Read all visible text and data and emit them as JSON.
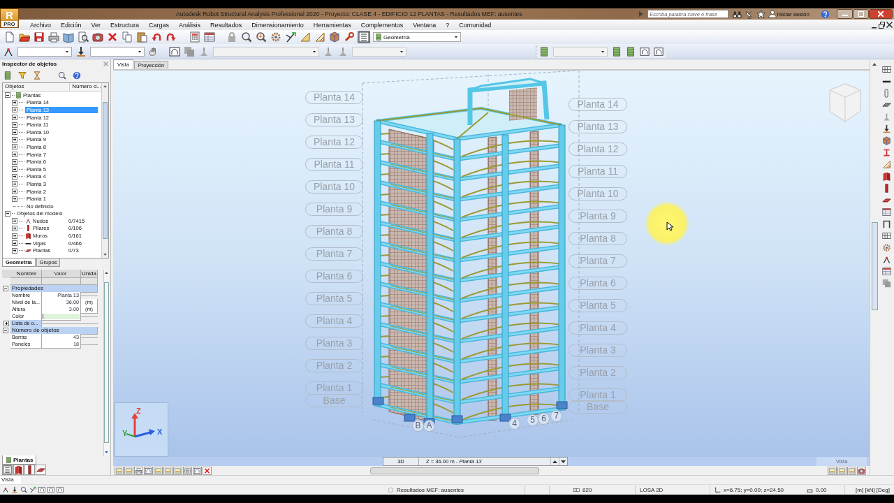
{
  "app_button": {
    "letter": "R",
    "label": "PRO"
  },
  "window": {
    "title": "Autodesk Robot Structural Analysis Professional 2020 - Proyecto: CLASE 4 - EDIFICIO 12 PLANTAS - Resultados MEF: ausentes"
  },
  "search": {
    "placeholder": "Escriba palabra clave o frase"
  },
  "sign_in": "Iniciar sesión",
  "menu": [
    "Archivo",
    "Edición",
    "Ver",
    "Estructura",
    "Cargas",
    "Análisis",
    "Resultados",
    "Dimensionamiento",
    "Herramientas",
    "Complementos",
    "Ventana",
    "?",
    "Comunidad"
  ],
  "toolbar": {
    "view_dropdown": "Geometría"
  },
  "inspector": {
    "title": "Inspector de objetos",
    "columns": [
      "Objetos",
      "Número d..."
    ],
    "tree": [
      {
        "label": "Plantas",
        "kind": "storeys",
        "expanded": true,
        "selected": false,
        "children": [
          {
            "label": "Planta 14",
            "kind": "storey",
            "expanded": false,
            "selected": false
          },
          {
            "label": "Planta 13",
            "kind": "storey",
            "expanded": false,
            "selected": true
          },
          {
            "label": "Planta 12",
            "kind": "storey",
            "expanded": false,
            "selected": false
          },
          {
            "label": "Planta 11",
            "kind": "storey",
            "expanded": false,
            "selected": false
          },
          {
            "label": "Planta 10",
            "kind": "storey",
            "expanded": false,
            "selected": false
          },
          {
            "label": "Planta 9",
            "kind": "storey",
            "expanded": false,
            "selected": false
          },
          {
            "label": "Planta 8",
            "kind": "storey",
            "expanded": false,
            "selected": false
          },
          {
            "label": "Planta 7",
            "kind": "storey",
            "expanded": false,
            "selected": false
          },
          {
            "label": "Planta 6",
            "kind": "storey",
            "expanded": false,
            "selected": false
          },
          {
            "label": "Planta 5",
            "kind": "storey",
            "expanded": false,
            "selected": false
          },
          {
            "label": "Planta 4",
            "kind": "storey",
            "expanded": false,
            "selected": false
          },
          {
            "label": "Planta 3",
            "kind": "storey",
            "expanded": false,
            "selected": false
          },
          {
            "label": "Planta 2",
            "kind": "storey",
            "expanded": false,
            "selected": false
          },
          {
            "label": "Planta 1",
            "kind": "storey",
            "expanded": false,
            "selected": false
          },
          {
            "label": "No definido",
            "kind": "leaf",
            "selected": false
          }
        ]
      },
      {
        "label": "Objetos del modelo",
        "kind": "group",
        "expanded": true,
        "selected": false,
        "children": [
          {
            "label": "Nudos",
            "kind": "node",
            "count": "0/7415",
            "expanded": false,
            "selected": false
          },
          {
            "label": "Pilares",
            "kind": "column",
            "count": "0/106",
            "expanded": false,
            "selected": false
          },
          {
            "label": "Muros",
            "kind": "wall",
            "count": "0/161",
            "expanded": false,
            "selected": false
          },
          {
            "label": "Vigas",
            "kind": "beam",
            "count": "0/466",
            "expanded": false,
            "selected": false
          },
          {
            "label": "Plantas",
            "kind": "slab",
            "count": "0/73",
            "expanded": false,
            "selected": false
          }
        ]
      }
    ],
    "tabs": [
      {
        "label": "Geometría",
        "selected": true
      },
      {
        "label": "Grupos",
        "selected": false
      }
    ]
  },
  "properties": {
    "columns": [
      "Nombre",
      "Valor",
      "Unida"
    ],
    "sections": [
      {
        "label": "Propiedades",
        "expanded": true,
        "rows": [
          {
            "kind": "text",
            "name": "Nombre",
            "value": "Planta 13"
          },
          {
            "kind": "text",
            "name": "Nivel de la...",
            "value": "36.00",
            "unit": "(m)"
          },
          {
            "kind": "text",
            "name": "Altura",
            "value": "3.00",
            "unit": "(m)"
          },
          {
            "kind": "color",
            "name": "Color",
            "color": "#dff3dc"
          },
          {
            "kind": "group",
            "name": "Lista de o...",
            "expanded": false
          }
        ]
      },
      {
        "label": "Número de objetos",
        "expanded": true,
        "rows": [
          {
            "kind": "text",
            "name": "Barras",
            "value": "43"
          },
          {
            "kind": "text",
            "name": "Paneles",
            "value": "18"
          }
        ]
      }
    ]
  },
  "panel_tab": "Plantas",
  "view_tabs": [
    {
      "label": "Vista",
      "selected": true
    },
    {
      "label": "Proyección",
      "selected": false
    }
  ],
  "viewport": {
    "left_levels": [
      "Planta 14",
      "Planta 13",
      "Planta 12",
      "Planta 11",
      "Planta 10",
      "Planta 9",
      "Planta 8",
      "Planta 7",
      "Planta 6",
      "Planta 5",
      "Planta 4",
      "Planta 3",
      "Planta 2",
      "Planta 1",
      "Base"
    ],
    "right_levels": [
      "Planta 14",
      "Planta 13",
      "Planta 12",
      "Planta 11",
      "Planta 10",
      "Planta 9",
      "Planta 8",
      "Planta 7",
      "Planta 6",
      "Planta 5",
      "Planta 4",
      "Planta 3",
      "Planta 2",
      "Planta 1",
      "Base"
    ],
    "grid_labels": [
      "B",
      "A",
      "4",
      "5",
      "6",
      "7"
    ],
    "axes": [
      {
        "label": "Z",
        "color": "#e8403a"
      },
      {
        "label": "Y",
        "color": "#2e9a3e"
      },
      {
        "label": "X",
        "color": "#2a5ee0"
      }
    ],
    "mode": "3D",
    "level": "Z = 36.00 m - *Planta 13*",
    "caption": "Vista"
  },
  "status": {
    "view": "Vista",
    "results": "Resultados MEF: ausentes",
    "count": "820",
    "section": "LOSA 2D",
    "coords": "x=6.75; y=0.00; z=24.50",
    "angle": "0.00",
    "units": "[m] [kN] [Deg]"
  }
}
